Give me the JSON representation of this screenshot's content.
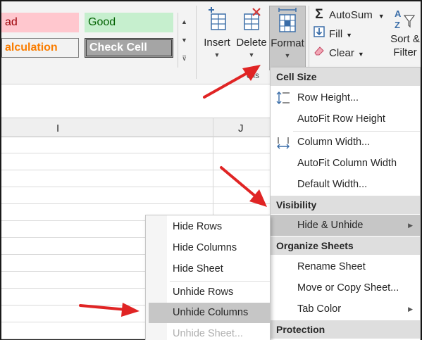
{
  "styles": {
    "bad": "ad",
    "good": "Good",
    "calculation": "alculation",
    "check_cell": "Check Cell",
    "scroll_up": "▲",
    "scroll_down": "▼",
    "more": "⊽"
  },
  "cells_group": {
    "insert": "Insert",
    "delete": "Delete",
    "format": "Format",
    "group_label": "ells"
  },
  "editing_group": {
    "autosum": "AutoSum",
    "fill": "Fill",
    "clear": "Clear",
    "sort_line1": "Sort &",
    "sort_line2": "Filter"
  },
  "grid": {
    "columns": [
      "I",
      "J"
    ]
  },
  "format_menu": {
    "cell_size_header": "Cell Size",
    "row_height": "Row Height...",
    "autofit_row_height": "AutoFit Row Height",
    "column_width": "Column Width...",
    "autofit_column_width": "AutoFit Column Width",
    "default_width": "Default Width...",
    "visibility_header": "Visibility",
    "hide_unhide": "Hide & Unhide",
    "organize_header": "Organize Sheets",
    "rename_sheet": "Rename Sheet",
    "move_copy_sheet": "Move or Copy Sheet...",
    "tab_color": "Tab Color",
    "protection_header": "Protection"
  },
  "hide_unhide_menu": {
    "hide_rows": "Hide Rows",
    "hide_columns": "Hide Columns",
    "hide_sheet": "Hide Sheet",
    "unhide_rows": "Unhide Rows",
    "unhide_columns": "Unhide Columns",
    "unhide_sheet": "Unhide Sheet..."
  },
  "colors": {
    "arrow": "#e02424",
    "highlight": "#c6c6c6",
    "ribbon": "#f3f3f3",
    "bad_fill": "#ffc7ce",
    "good_fill": "#c6efce",
    "calc_text": "#fa7d00"
  }
}
